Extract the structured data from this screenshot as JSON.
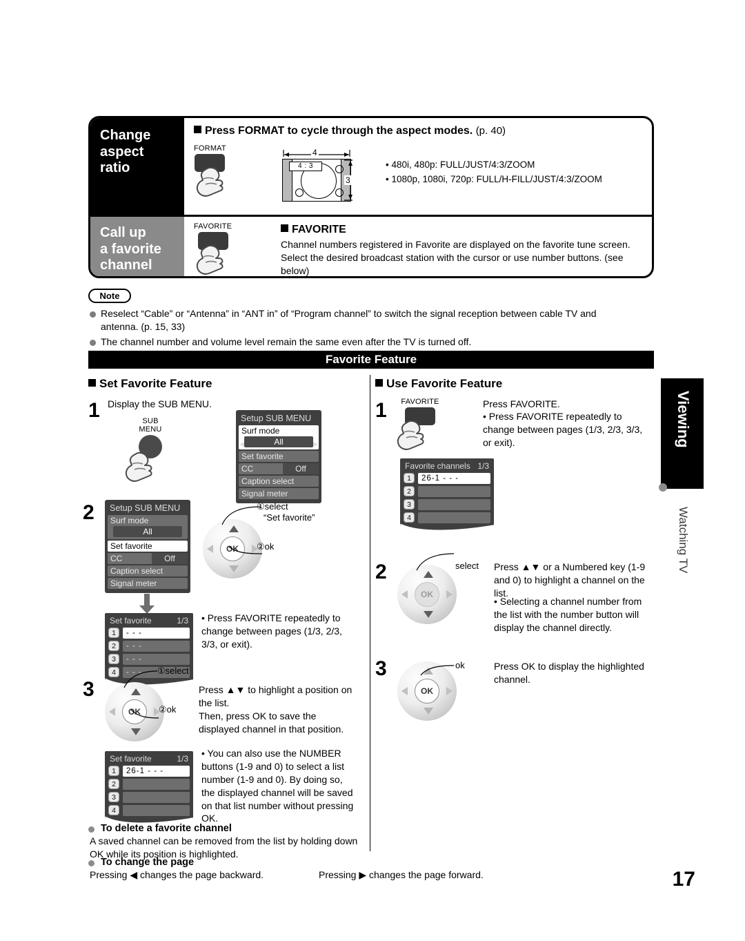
{
  "top_panel": {
    "rows": [
      {
        "label": "Change\naspect\nratio",
        "button_caption": "FORMAT",
        "heading": "Press FORMAT to cycle through the aspect modes.",
        "heading_page": "(p. 40)",
        "diagram": {
          "width_label": "4",
          "height_label": "3",
          "ratio_tag": "4 : 3"
        },
        "mode_lines": [
          "• 480i, 480p:  FULL/JUST/4:3/ZOOM",
          "• 1080p, 1080i, 720p:  FULL/H-FILL/JUST/4:3/ZOOM"
        ]
      },
      {
        "label": "Call up\na favorite\nchannel",
        "button_caption": "FAVORITE",
        "heading": "FAVORITE",
        "body": "Channel numbers registered in Favorite are displayed on the favorite tune screen. Select the desired broadcast station with the cursor or use number buttons. (see below)"
      }
    ]
  },
  "note": {
    "label": "Note",
    "items": [
      "Reselect “Cable” or “Antenna” in “ANT in” of “Program channel” to switch the signal reception between cable TV and antenna. (p. 15, 33)",
      "The channel number and volume level remain the same even after the TV is turned off."
    ]
  },
  "banner": "Favorite Feature",
  "left_column": {
    "heading": "Set Favorite Feature",
    "step1": {
      "number": "1",
      "text": "Display the SUB MENU.",
      "button_caption_line1": "SUB",
      "button_caption_line2": "MENU",
      "menu": {
        "title": "Setup SUB MENU",
        "group_label": "Surf mode",
        "group_value": "All",
        "rows": [
          {
            "label": "Set favorite",
            "value": "",
            "selected": false
          },
          {
            "label": "CC",
            "value": "Off",
            "selected": false
          },
          {
            "label": "Caption select",
            "value": "",
            "selected": false
          },
          {
            "label": "Signal meter",
            "value": "",
            "selected": false
          }
        ]
      }
    },
    "step2": {
      "number": "2",
      "menu": {
        "title": "Setup SUB MENU",
        "group_label": "Surf mode",
        "group_value": "All",
        "rows": [
          {
            "label": "Set favorite",
            "value": "",
            "selected": true
          },
          {
            "label": "CC",
            "value": "Off",
            "selected": false
          },
          {
            "label": "Caption select",
            "value": "",
            "selected": false
          },
          {
            "label": "Signal meter",
            "value": "",
            "selected": false
          }
        ]
      },
      "callout_1": "①select",
      "callout_1b": "“Set favorite”",
      "callout_2": "②ok",
      "ok_label": "OK",
      "favlist": {
        "title": "Set favorite",
        "page": "1/3",
        "rows": [
          {
            "num": "1",
            "value": "- - -",
            "selected": true
          },
          {
            "num": "2",
            "value": "- - -",
            "selected": false
          },
          {
            "num": "3",
            "value": "- - -",
            "selected": false
          },
          {
            "num": "4",
            "value": "- - -",
            "selected": false
          }
        ]
      },
      "note": "• Press FAVORITE repeatedly to change between pages (1/3, 2/3, 3/3, or exit)."
    },
    "step3": {
      "number": "3",
      "callout_1": "①select",
      "callout_2": "②ok",
      "ok_label": "OK",
      "text": "Press ▲▼ to highlight a position on the list.\nThen, press OK to save the displayed channel in that position.",
      "favlist": {
        "title": "Set favorite",
        "page": "1/3",
        "rows": [
          {
            "num": "1",
            "value": "26-1     - - -",
            "selected": true
          },
          {
            "num": "2",
            "value": "",
            "selected": false
          },
          {
            "num": "3",
            "value": "",
            "selected": false
          },
          {
            "num": "4",
            "value": "",
            "selected": false
          }
        ]
      },
      "note": "• You can also use the NUMBER buttons (1-9 and 0) to select a list number (1-9 and 0). By doing so, the displayed channel will be saved on that list number without pressing OK."
    },
    "delete_section": {
      "heading": "To delete a favorite channel",
      "body": "A saved channel can be removed from the list by holding down OK while its position is highlighted."
    },
    "page_section": {
      "heading": "To change the page",
      "left": "Pressing ◀ changes the page backward.",
      "right": "Pressing ▶ changes the page forward."
    }
  },
  "right_column": {
    "heading": "Use Favorite Feature",
    "step1": {
      "number": "1",
      "button_caption": "FAVORITE",
      "text": "Press FAVORITE.",
      "note": "• Press FAVORITE repeatedly to change between pages (1/3, 2/3, 3/3, or exit).",
      "favlist": {
        "title": "Favorite channels",
        "page": "1/3",
        "rows": [
          {
            "num": "1",
            "value": "26-1     - - -",
            "selected": true
          },
          {
            "num": "2",
            "value": "",
            "selected": false
          },
          {
            "num": "3",
            "value": "",
            "selected": false
          },
          {
            "num": "4",
            "value": "",
            "selected": false
          }
        ]
      }
    },
    "step2": {
      "number": "2",
      "callout": "select",
      "ok_label": "OK",
      "text": "Press ▲▼ or a Numbered key (1-9 and 0) to highlight a channel on the list.",
      "note": "• Selecting a channel number from the list with the number button will display the channel directly."
    },
    "step3": {
      "number": "3",
      "callout": "ok",
      "ok_label": "OK",
      "text": "Press OK to display the highlighted channel."
    }
  },
  "side_tab": {
    "title": "Viewing",
    "subtitle": "Watching TV"
  },
  "page_number": "17"
}
